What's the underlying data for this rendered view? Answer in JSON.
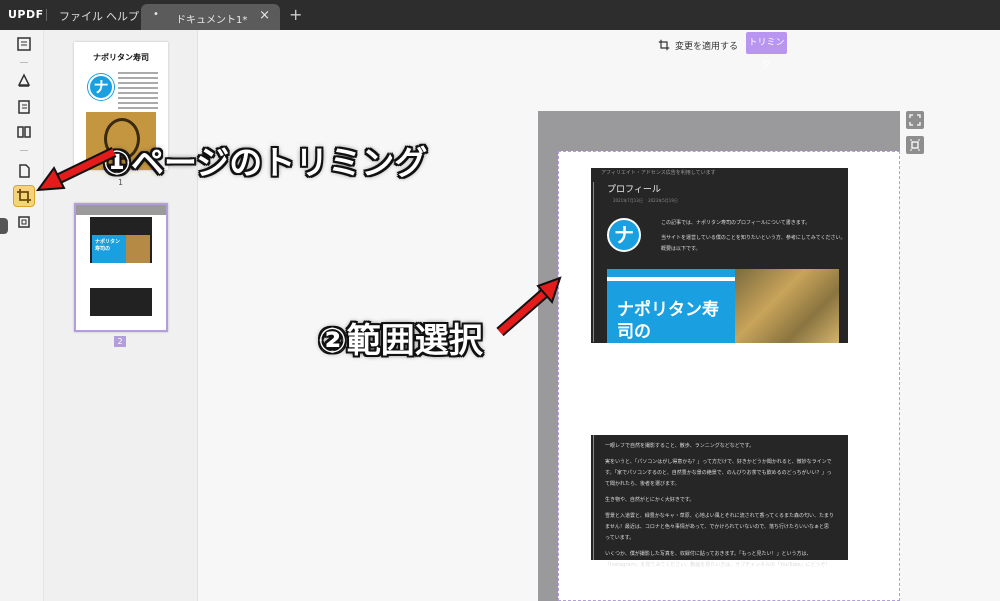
{
  "app": {
    "logo": "UPDF",
    "menu": [
      "ファイル",
      "ヘルプ"
    ]
  },
  "tab": {
    "title": "ドキュメント1*",
    "close": "×",
    "new": "+"
  },
  "toolbar": {
    "apply_label": "変更を適用する",
    "trim_label": "トリミング"
  },
  "thumbnails": [
    {
      "page": "1",
      "title": "ナポリタン寿司"
    },
    {
      "page": "2"
    }
  ],
  "page": {
    "card1": {
      "header": "アフィリエイト・アドセンス広告を利用しています",
      "title": "プロフィール",
      "date": "2021年7月13日 　2023年5月19日",
      "desc1": "この記事では、ナポリタン寿司のプロフィールについて書きます。",
      "desc2": "当サイトを運営している僕のことを知りたいという方、参考にしてみてください。",
      "desc3": "概要は以下です。",
      "banner": "ナポリタン寿司の"
    },
    "card2": {
      "p1": "一眼レフで自然を撮影すること、散歩、ランニングなどなどです。",
      "p2": "実をいうと、「パソコンはがし得意かも？」って方だけで、好きかどうか聞かれると、微妙なラインです。「家でパソコンするのと、自然豊かな景の絶景で、のんびりお茶でも飲めるのどっちがいい？」って聞かれたら、後者を選びます。",
      "p3": "生き物や、自然がとにかく大好きです。",
      "p4": "雪景と入道雲と、緑豊かなキャ・草原、心地よい風とそれに流されて香ってくるまた森の匂い、たまりません！最近は、コロナと色々事情があって、でかけられていないので、落ち行けたらいいなぁと思っています。",
      "p5": "いくつか、僕が撮影した写真を、収録付に貼っておきます。「もっと見たい！」という方は、「Instagram」を見てみてください。動画を見たい方は、サブチャンネルの「YouTube」にどうぞ！"
    }
  },
  "annotations": {
    "a1": "①ページのトリミング",
    "a2": "②範囲選択"
  },
  "colors": {
    "accent": "#b895f0",
    "active_tool": "#f4d37a",
    "annotation_arrow": "#e31b1b"
  }
}
